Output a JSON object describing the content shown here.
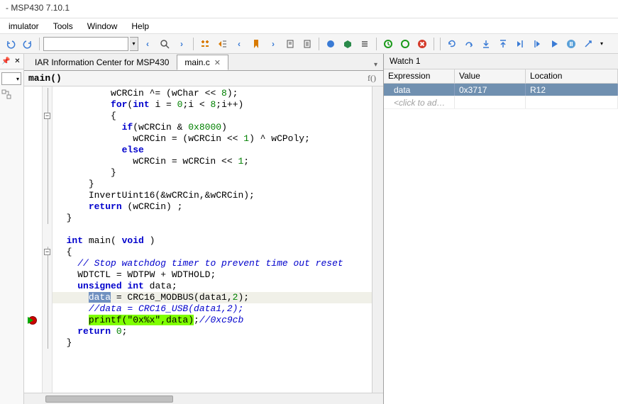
{
  "window": {
    "title": "- MSP430 7.10.1"
  },
  "menu": {
    "items": [
      "imulator",
      "Tools",
      "Window",
      "Help"
    ]
  },
  "tabs": {
    "items": [
      {
        "label": "IAR Information Center for MSP430",
        "active": false,
        "closable": false
      },
      {
        "label": "main.c",
        "active": true,
        "closable": true
      }
    ]
  },
  "fn_bar": {
    "text": "main()",
    "indicator": "f()"
  },
  "code": {
    "lines": [
      {
        "indent": 10,
        "segs": [
          {
            "t": "wCRCin ^= (wChar << "
          },
          {
            "t": "8",
            "c": "num"
          },
          {
            "t": ");"
          }
        ]
      },
      {
        "indent": 10,
        "segs": [
          {
            "t": "for",
            "c": "kw"
          },
          {
            "t": "("
          },
          {
            "t": "int",
            "c": "kw"
          },
          {
            "t": " i = "
          },
          {
            "t": "0",
            "c": "num"
          },
          {
            "t": ";i < "
          },
          {
            "t": "8",
            "c": "num"
          },
          {
            "t": ";i++)"
          }
        ]
      },
      {
        "indent": 10,
        "segs": [
          {
            "t": "{"
          }
        ]
      },
      {
        "indent": 12,
        "segs": [
          {
            "t": "if",
            "c": "kw"
          },
          {
            "t": "(wCRCin & "
          },
          {
            "t": "0x8000",
            "c": "num"
          },
          {
            "t": ")"
          }
        ]
      },
      {
        "indent": 14,
        "segs": [
          {
            "t": "wCRCin = (wCRCin << "
          },
          {
            "t": "1",
            "c": "num"
          },
          {
            "t": ") ^ wCPoly;"
          }
        ]
      },
      {
        "indent": 12,
        "segs": [
          {
            "t": "else",
            "c": "kw"
          }
        ]
      },
      {
        "indent": 14,
        "segs": [
          {
            "t": "wCRCin = wCRCin << "
          },
          {
            "t": "1",
            "c": "num"
          },
          {
            "t": ";"
          }
        ]
      },
      {
        "indent": 10,
        "segs": [
          {
            "t": "}"
          }
        ]
      },
      {
        "indent": 6,
        "segs": [
          {
            "t": "}"
          }
        ]
      },
      {
        "indent": 6,
        "segs": [
          {
            "t": "InvertUint16(&wCRCin,&wCRCin);"
          }
        ]
      },
      {
        "indent": 6,
        "segs": [
          {
            "t": "return",
            "c": "kw"
          },
          {
            "t": " (wCRCin) ;"
          }
        ]
      },
      {
        "indent": 2,
        "segs": [
          {
            "t": "}"
          }
        ]
      },
      {
        "indent": 0,
        "segs": []
      },
      {
        "indent": 2,
        "segs": [
          {
            "t": "int",
            "c": "kw"
          },
          {
            "t": " main( "
          },
          {
            "t": "void",
            "c": "kw"
          },
          {
            "t": " )"
          }
        ]
      },
      {
        "indent": 2,
        "segs": [
          {
            "t": "{"
          }
        ]
      },
      {
        "indent": 4,
        "segs": [
          {
            "t": "// Stop watchdog timer to prevent time out reset",
            "c": "cmt"
          }
        ]
      },
      {
        "indent": 4,
        "segs": [
          {
            "t": "WDTCTL = WDTPW + WDTHOLD;"
          }
        ]
      },
      {
        "indent": 4,
        "segs": [
          {
            "t": "unsigned",
            "c": "kw"
          },
          {
            "t": " "
          },
          {
            "t": "int",
            "c": "kw"
          },
          {
            "t": " data;"
          }
        ]
      },
      {
        "indent": 6,
        "segs": [
          {
            "t": "data",
            "c": "sel-var"
          },
          {
            "t": " = CRC16_MODBUS(data1,"
          },
          {
            "t": "2",
            "c": "num"
          },
          {
            "t": ");"
          }
        ],
        "row_class": "hl-cur"
      },
      {
        "indent": 6,
        "segs": [
          {
            "t": "//data = CRC16_USB(data1,2);",
            "c": "cmt"
          }
        ]
      },
      {
        "indent": 6,
        "segs": [
          {
            "t": "printf(\"0x%x\",data)",
            "c": "exec-hl"
          },
          {
            "t": ";"
          },
          {
            "t": "//0xc9cb",
            "c": "cmt"
          }
        ],
        "marker": "bp-arrow"
      },
      {
        "indent": 4,
        "segs": [
          {
            "t": "return",
            "c": "kw"
          },
          {
            "t": " "
          },
          {
            "t": "0",
            "c": "num"
          },
          {
            "t": ";"
          }
        ]
      },
      {
        "indent": 2,
        "segs": [
          {
            "t": "}"
          }
        ]
      }
    ],
    "fold_boxes": [
      2,
      14
    ],
    "fold_line_ranges": [
      [
        0,
        12
      ],
      [
        14,
        23
      ]
    ]
  },
  "watch": {
    "title": "Watch 1",
    "columns": [
      "Expression",
      "Value",
      "Location"
    ],
    "rows": [
      {
        "expr": "data",
        "value": "0x3717",
        "loc": "R12",
        "selected": true
      }
    ],
    "placeholder": "<click to ad…"
  },
  "toolbar_icons": {
    "undo": "↶",
    "redo": "↷",
    "nav_back": "‹",
    "search": "🔍",
    "nav_fwd": "›",
    "goto": "⇄",
    "step_to": "▸≡",
    "prev_bm": "‹",
    "bookmark": "⬥",
    "next_bm": "›",
    "doc1": "⎘",
    "doc2": "⎘",
    "compile": "⬤",
    "build": "⯃",
    "list": "≡",
    "go": "⭮",
    "stop_dbg": "⭯",
    "stop": "✖",
    "reset": "↻",
    "step_over": "↷",
    "step_into": "↳",
    "step_out": "↰",
    "run_to": "▸|",
    "next_stmt": "|▸",
    "run": "▶",
    "pause": "⏸",
    "halt": "⤫"
  }
}
